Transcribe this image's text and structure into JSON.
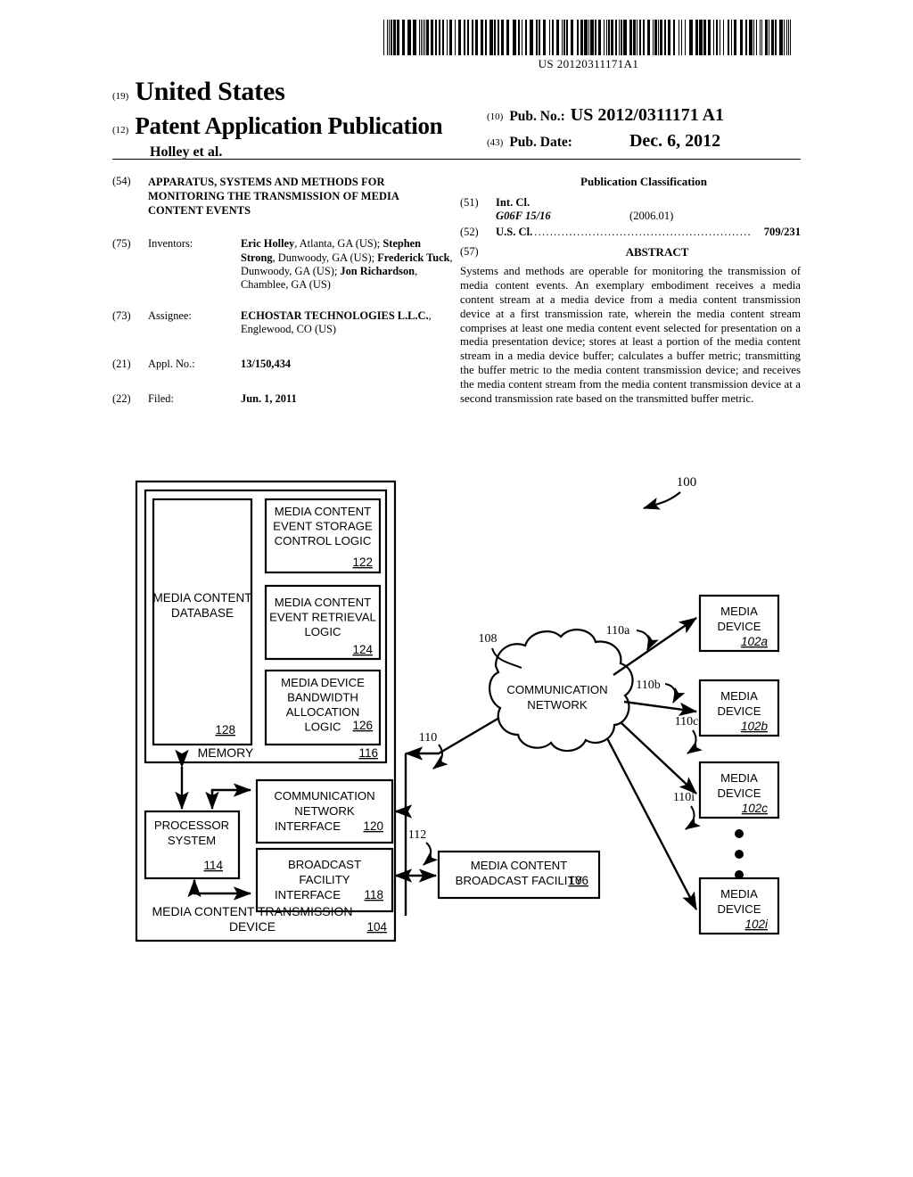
{
  "header": {
    "barcode_number": "US 20120311171A1",
    "code_19": "(19)",
    "country": "United States",
    "code_12": "(12)",
    "doc_type": "Patent Application Publication",
    "author_line": "Holley et al.",
    "code_10": "(10)",
    "pub_no_label": "Pub. No.:",
    "pub_no_value": "US 2012/0311171 A1",
    "code_43": "(43)",
    "pub_date_label": "Pub. Date:",
    "pub_date_value": "Dec. 6, 2012"
  },
  "left_column": {
    "title": {
      "code": "(54)",
      "text": "APPARATUS, SYSTEMS AND METHODS FOR MONITORING THE TRANSMISSION OF MEDIA CONTENT EVENTS"
    },
    "inventors": {
      "code": "(75)",
      "term": "Inventors:",
      "names": [
        {
          "name": "Eric Holley",
          "location": ", Atlanta, GA (US);"
        },
        {
          "name": "Stephen Strong",
          "location": ", Dunwoody, GA (US);"
        },
        {
          "name": "Frederick Tuck",
          "location": ", Dunwoody, GA (US);"
        },
        {
          "name": "Jon Richardson",
          "location": ", Chamblee, GA (US)"
        }
      ]
    },
    "assignee": {
      "code": "(73)",
      "term": "Assignee:",
      "name": "ECHOSTAR TECHNOLOGIES L.L.C.",
      "location": ", Englewood, CO (US)"
    },
    "appl_no": {
      "code": "(21)",
      "term": "Appl. No.:",
      "value": "13/150,434"
    },
    "filed": {
      "code": "(22)",
      "term": "Filed:",
      "value": "Jun. 1, 2011"
    }
  },
  "right_column": {
    "pub_classification_heading": "Publication Classification",
    "int_cl": {
      "code": "(51)",
      "label": "Int. Cl.",
      "symbol": "G06F 15/16",
      "version": "(2006.01)"
    },
    "us_cl": {
      "code": "(52)",
      "label": "U.S. Cl.",
      "dots": "........................................................",
      "value": "709/231"
    },
    "abstract": {
      "code": "(57)",
      "heading": "ABSTRACT",
      "text": "Systems and methods are operable for monitoring the transmission of media content events. An exemplary embodiment receives a media content stream at a media device from a media content transmission device at a first transmission rate, wherein the media content stream comprises at least one media content event selected for presentation on a media presentation device; stores at least a portion of the media content stream in a media device buffer; calculates a buffer metric; transmitting the buffer metric to the media content transmission device; and receives the media content stream from the media content transmission device at a second transmission rate based on the transmitted buffer metric."
    }
  },
  "figure": {
    "figure_ref": "100",
    "transmission_device": {
      "label_line1": "MEDIA CONTENT TRANSMISSION",
      "label_line2": "DEVICE",
      "ref": "104"
    },
    "memory": {
      "label": "MEMORY",
      "ref": "116"
    },
    "database": {
      "label_line1": "MEDIA CONTENT",
      "label_line2": "DATABASE",
      "ref": "128"
    },
    "logic_blocks": [
      {
        "lines": [
          "MEDIA CONTENT",
          "EVENT STORAGE",
          "CONTROL LOGIC"
        ],
        "ref": "122",
        "ref_inline": false
      },
      {
        "lines": [
          "MEDIA CONTENT",
          "EVENT RETRIEVAL",
          "LOGIC"
        ],
        "ref": "124",
        "ref_inline": false
      },
      {
        "lines": [
          "MEDIA DEVICE",
          "BANDWIDTH",
          "ALLOCATION",
          "LOGIC"
        ],
        "ref": "126",
        "ref_inline": true
      }
    ],
    "processor": {
      "label_line1": "PROCESSOR",
      "label_line2": "SYSTEM",
      "ref": "114"
    },
    "network_interface": {
      "label_line1": "COMMUNICATION",
      "label_line2": "NETWORK",
      "label_line3": "INTERFACE",
      "ref": "120"
    },
    "broadcast_interface": {
      "label_line1": "BROADCAST",
      "label_line2": "FACILITY",
      "label_line3": "INTERFACE",
      "ref": "118"
    },
    "cloud": {
      "label_line1": "COMMUNICATION",
      "label_line2": "NETWORK",
      "ref": "108"
    },
    "broadcast_facility": {
      "label_line1": "MEDIA CONTENT",
      "label_line2": "BROADCAST FACILITY",
      "ref": "106"
    },
    "media_devices": [
      {
        "line1": "MEDIA",
        "line2": "DEVICE",
        "ref": "102a"
      },
      {
        "line1": "MEDIA",
        "line2": "DEVICE",
        "ref": "102b"
      },
      {
        "line1": "MEDIA",
        "line2": "DEVICE",
        "ref": "102c"
      },
      {
        "line1": "MEDIA",
        "line2": "DEVICE",
        "ref": "102i"
      }
    ],
    "link_labels": {
      "l110": "110",
      "l110a": "110a",
      "l110b": "110b",
      "l110c": "110c",
      "l110i": "110i",
      "l112": "112"
    }
  }
}
